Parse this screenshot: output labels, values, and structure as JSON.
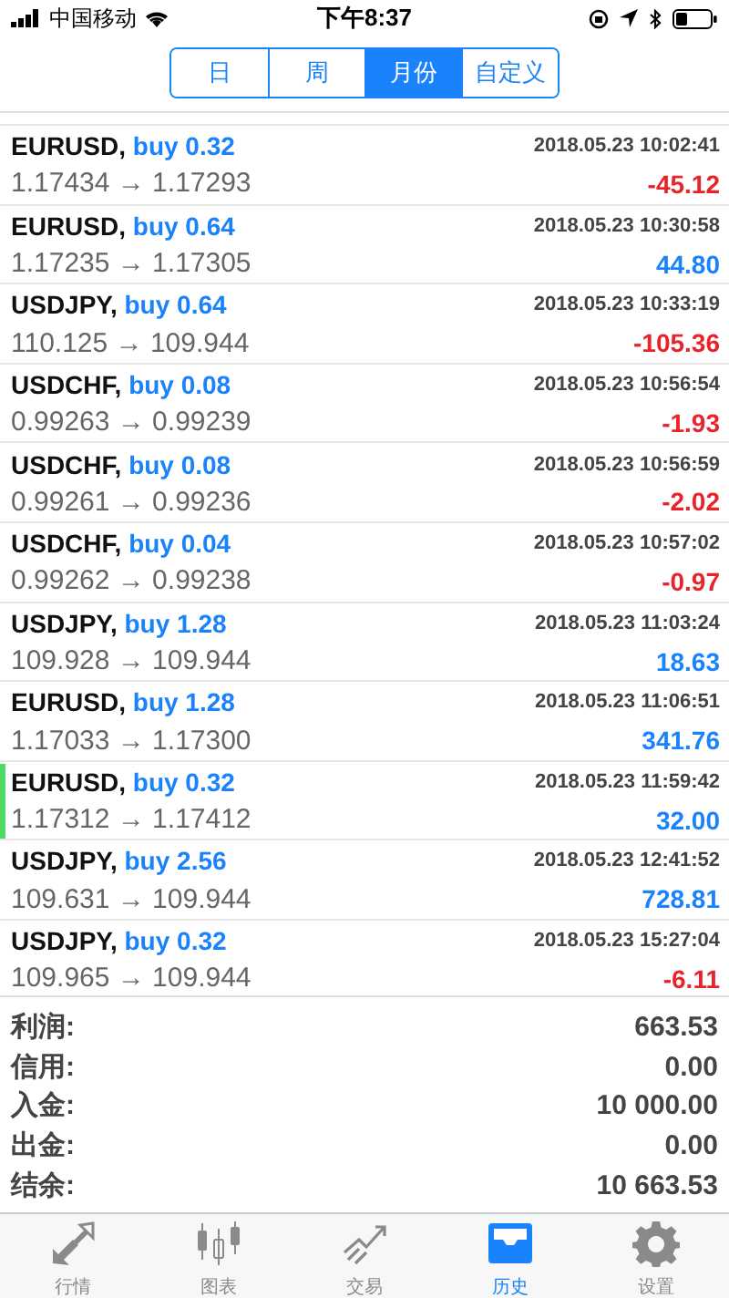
{
  "status_bar": {
    "carrier": "中国移动",
    "time": "下午8:37"
  },
  "period_tabs": [
    {
      "label": "日",
      "selected": false
    },
    {
      "label": "周",
      "selected": false
    },
    {
      "label": "月份",
      "selected": true
    },
    {
      "label": "自定义",
      "selected": false
    }
  ],
  "trades": [
    {
      "symbol": "EURUSD,",
      "side": "buy 0.32",
      "time": "2018.05.23 10:02:41",
      "prices": "1.17434 → 1.17293",
      "profit": "-45.12",
      "kind": "loss",
      "selected": false
    },
    {
      "symbol": "EURUSD,",
      "side": "buy 0.64",
      "time": "2018.05.23 10:30:58",
      "prices": "1.17235 → 1.17305",
      "profit": "44.80",
      "kind": "gain",
      "selected": false
    },
    {
      "symbol": "USDJPY,",
      "side": "buy 0.64",
      "time": "2018.05.23 10:33:19",
      "prices": "110.125 → 109.944",
      "profit": "-105.36",
      "kind": "loss",
      "selected": false
    },
    {
      "symbol": "USDCHF,",
      "side": "buy 0.08",
      "time": "2018.05.23 10:56:54",
      "prices": "0.99263 → 0.99239",
      "profit": "-1.93",
      "kind": "loss",
      "selected": false
    },
    {
      "symbol": "USDCHF,",
      "side": "buy 0.08",
      "time": "2018.05.23 10:56:59",
      "prices": "0.99261 → 0.99236",
      "profit": "-2.02",
      "kind": "loss",
      "selected": false
    },
    {
      "symbol": "USDCHF,",
      "side": "buy 0.04",
      "time": "2018.05.23 10:57:02",
      "prices": "0.99262 → 0.99238",
      "profit": "-0.97",
      "kind": "loss",
      "selected": false
    },
    {
      "symbol": "USDJPY,",
      "side": "buy 1.28",
      "time": "2018.05.23 11:03:24",
      "prices": "109.928 → 109.944",
      "profit": "18.63",
      "kind": "gain",
      "selected": false
    },
    {
      "symbol": "EURUSD,",
      "side": "buy 1.28",
      "time": "2018.05.23 11:06:51",
      "prices": "1.17033 → 1.17300",
      "profit": "341.76",
      "kind": "gain",
      "selected": false
    },
    {
      "symbol": "EURUSD,",
      "side": "buy 0.32",
      "time": "2018.05.23 11:59:42",
      "prices": "1.17312 → 1.17412",
      "profit": "32.00",
      "kind": "gain",
      "selected": true
    },
    {
      "symbol": "USDJPY,",
      "side": "buy 2.56",
      "time": "2018.05.23 12:41:52",
      "prices": "109.631 → 109.944",
      "profit": "728.81",
      "kind": "gain",
      "selected": false
    },
    {
      "symbol": "USDJPY,",
      "side": "buy 0.32",
      "time": "2018.05.23 15:27:04",
      "prices": "109.965 → 109.944",
      "profit": "-6.11",
      "kind": "loss",
      "selected": false
    }
  ],
  "summary": [
    {
      "label": "利润:",
      "value": "663.53"
    },
    {
      "label": "信用:",
      "value": "0.00"
    },
    {
      "label": "入金:",
      "value": "10 000.00"
    },
    {
      "label": "出金:",
      "value": "0.00"
    },
    {
      "label": "结余:",
      "value": "10 663.53"
    }
  ],
  "tab_bar": [
    {
      "label": "行情",
      "selected": false
    },
    {
      "label": "图表",
      "selected": false
    },
    {
      "label": "交易",
      "selected": false
    },
    {
      "label": "历史",
      "selected": true
    },
    {
      "label": "设置",
      "selected": false
    }
  ]
}
